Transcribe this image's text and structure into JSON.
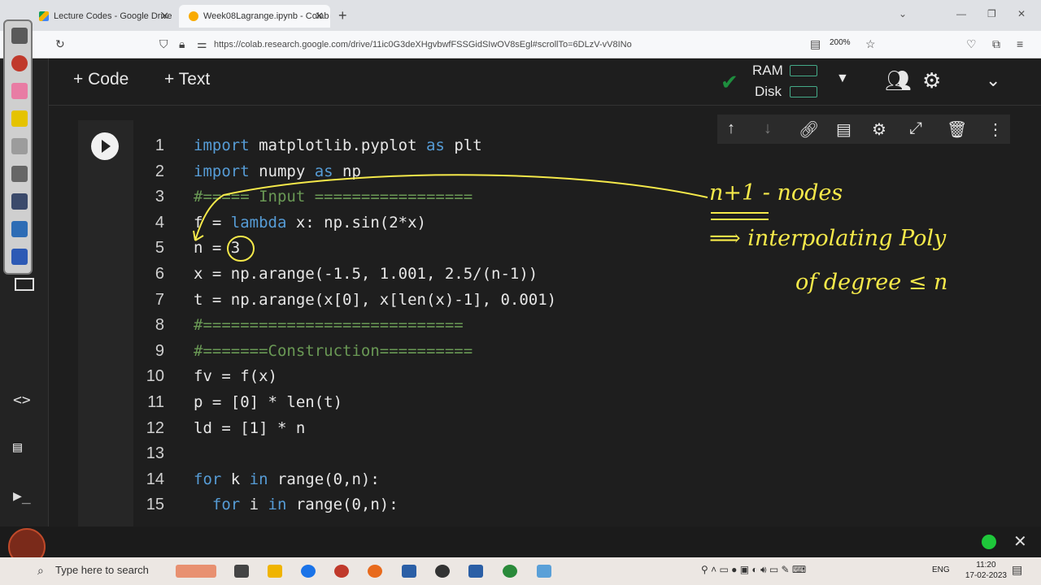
{
  "browser": {
    "tabs": [
      {
        "title": "Lecture Codes - Google Drive",
        "active": false
      },
      {
        "title": "Week08Lagrange.ipynb - Colab",
        "active": true
      }
    ],
    "url": "https://colab.research.google.com/drive/11ic0G3deXHgvbwfFSSGidSIwOV8sEgl#scrollTo=6DLzV-vV8INo",
    "zoom": "200%"
  },
  "toolbar": {
    "code_label": "Code",
    "text_label": "Text",
    "ram_label": "RAM",
    "disk_label": "Disk"
  },
  "code_lines": [
    {
      "n": "1"
    },
    {
      "n": "2"
    },
    {
      "n": "3"
    },
    {
      "n": "4"
    },
    {
      "n": "5"
    },
    {
      "n": "6"
    },
    {
      "n": "7"
    },
    {
      "n": "8"
    },
    {
      "n": "9"
    },
    {
      "n": "10"
    },
    {
      "n": "11"
    },
    {
      "n": "12"
    },
    {
      "n": "13"
    },
    {
      "n": "14"
    },
    {
      "n": "15"
    }
  ],
  "code": {
    "l1a": "import",
    "l1b": " matplotlib.pyplot ",
    "l1c": "as",
    "l1d": " plt",
    "l2a": "import",
    "l2b": " numpy ",
    "l2c": "as",
    "l2d": " np",
    "l3": "#===== Input =================",
    "l4a": "f = ",
    "l4b": "lambda",
    "l4c": " x: np.sin(2*x)",
    "l5": "n = 3",
    "l6": "x = np.arange(-1.5, 1.001, 2.5/(n-1))",
    "l7": "t = np.arange(x[0], x[len(x)-1], 0.001)",
    "l8": "#============================",
    "l9": "#=======Construction==========",
    "l10": "fv = f(x)",
    "l11": "p = [0] * len(t)",
    "l12": "ld = [1] * n",
    "l13": "",
    "l14a": "for",
    "l14b": " k ",
    "l14c": "in",
    "l14d": " range(0,n):",
    "l15a": "  for",
    "l15b": " i ",
    "l15c": "in",
    "l15d": " range(0,n):"
  },
  "annotations": {
    "line1": "n+1 - nodes",
    "line2": "⟹ interpolating Poly",
    "line3": "of degree ≤ n"
  },
  "taskbar": {
    "search_placeholder": "Type here to search",
    "lang": "ENG",
    "time": "11:20",
    "date": "17-02-2023"
  }
}
